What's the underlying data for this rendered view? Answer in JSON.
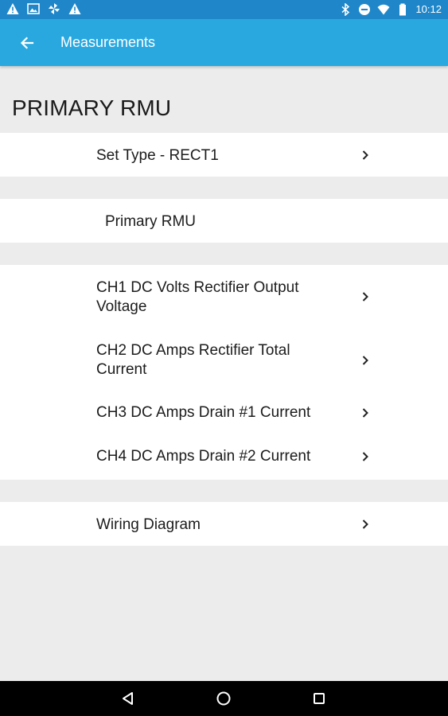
{
  "status_bar": {
    "time": "10:12",
    "left_icons": [
      "warning-icon",
      "image-icon",
      "pinwheel-icon",
      "warning-icon"
    ],
    "right_icons": [
      "bluetooth-icon",
      "do-not-disturb-icon",
      "wifi-icon",
      "battery-icon"
    ]
  },
  "app_bar": {
    "title": "Measurements",
    "back_icon": "arrow-left-icon",
    "color": "#29a8e0"
  },
  "page": {
    "title": "PRIMARY RMU"
  },
  "set_type": {
    "label": "Set Type - RECT1"
  },
  "info": {
    "label": "Primary RMU"
  },
  "channels": [
    {
      "label": "CH1 DC Volts Rectifier Output Voltage"
    },
    {
      "label": "CH2 DC Amps Rectifier Total Current"
    },
    {
      "label": "CH3 DC Amps Drain #1 Current"
    },
    {
      "label": "CH4 DC Amps Drain #2 Current"
    }
  ],
  "wiring": {
    "label": "Wiring Diagram"
  },
  "nav_bar": {
    "icons": [
      "back-triangle-icon",
      "home-circle-icon",
      "recents-square-icon"
    ]
  }
}
